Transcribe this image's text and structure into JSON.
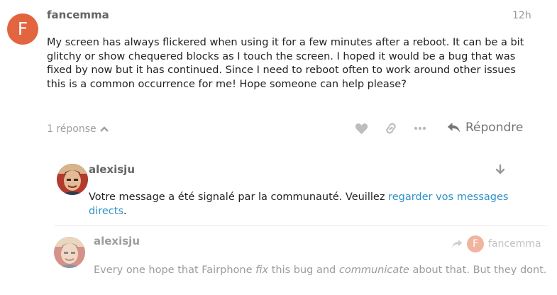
{
  "post": {
    "avatar_letter": "F",
    "username": "fancemma",
    "time": "12h",
    "body": "My screen has always flickered when using it for a few minutes after a reboot. It can be a bit glitchy or show chequered blocks as I touch the screen. I hoped it would be a bug that was fixed by now but it has continued. Since I need to reboot often to work around other issues this is a common occurrence for me! Hope someone can help please?"
  },
  "actions": {
    "replies_label": "1 réponse",
    "reply_label": "Répondre"
  },
  "nested_reply_1": {
    "username": "alexisju",
    "text_before": "Votre message a été signalé par la communauté. Veuillez ",
    "link_text": "regarder vos messages directs",
    "text_after": "."
  },
  "nested_reply_2": {
    "username": "alexisju",
    "reply_to_letter": "F",
    "reply_to_user": "fancemma",
    "body_1": "Every one hope that Fairphone ",
    "body_em1": "fix",
    "body_2": " this bug and ",
    "body_em2": "communicate",
    "body_3": " about that. But they dont."
  },
  "colors": {
    "avatar_f": "#e2653f",
    "link": "#2f91c9"
  }
}
